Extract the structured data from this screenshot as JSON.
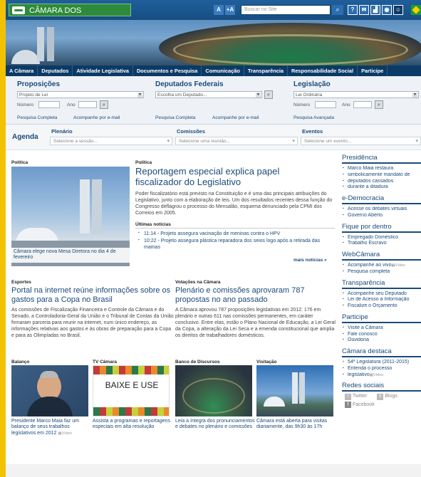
{
  "header": {
    "logo": "CÂMARA DOS DEPUTADOS",
    "font_smaller": "A",
    "font_larger": "+A",
    "search_placeholder": "Buscar no Site",
    "icons": [
      "help-icon",
      "mail-icon",
      "chart-icon",
      "rss-icon",
      "flag-icon"
    ],
    "help": "?"
  },
  "nav": [
    "A Câmara",
    "Deputados",
    "Atividade Legislativa",
    "Documentos e Pesquisa",
    "Comunicação",
    "Transparência",
    "Responsabilidade Social",
    "Participe"
  ],
  "panel": {
    "proposicoes": {
      "title": "Proposições",
      "select": "Projeto de Lei",
      "numero": "Número",
      "ano": "Ano",
      "link1": "Pesquisa Completa",
      "link2": "Acompanhe por e-mail"
    },
    "deputados": {
      "title": "Deputados Federais",
      "select": "Escolha um Deputado...",
      "link1": "Pesquisa Completa",
      "link2": "Acompanhe por e-mail"
    },
    "legislacao": {
      "title": "Legislação",
      "select": "Lei Ordinária",
      "numero": "Número",
      "ano": "Ano",
      "link1": "Pesquisa Avançada"
    }
  },
  "agenda": {
    "title": "Agenda",
    "plenario": "Plenário",
    "plenario_sel": "Selecione a sessão...",
    "comissoes": "Comissões",
    "comissoes_sel": "Selecione uma reunião...",
    "eventos": "Eventos",
    "eventos_sel": "Selecione um evento..."
  },
  "main": {
    "left_section": "Política",
    "photo_caption": "Câmara elege nova Mesa Diretora no dia 4 de fevereiro",
    "right_section": "Política",
    "headline": "Reportagem especial explica papel fiscalizador do Legislativo",
    "lead": "Poder fiscalizatório está previsto na Constituição e é uma das principais atribuições do Legislativo, junto com a elaboração de leis. Um dos resultados recentes dessa função do Congresso deflagrou o processo do Mensalão, esquema denunciado pela CPMI dos Correios em 2005.",
    "ultimas": "Últimas notícias",
    "news": [
      "11:14 - Projeto assegura vacinação de meninas contra o HPV",
      "10:22 - Projeto assegura plástica reparadora dos seios logo após a retirada das mamas"
    ],
    "more": "mais notícias »"
  },
  "stories": [
    {
      "section": "Esportes",
      "headline": "Portal na internet reúne informações sobre os gastos para a Copa no Brasil",
      "body": "As comissões de Fiscalização Financeira e Controle da Câmara e do Senado, a Controladoria-Geral da União e o Tribunal de Contas da União firmaram parceria para reunir na internet, num único endereço, as informações relativas aos gastos e às obras de preparação para a Copa e para as Olimpíadas no Brasil."
    },
    {
      "section": "Votações na Câmara",
      "headline": "Plenário e comissões aprovaram 787 propostas no ano passado",
      "body": "A Câmara aprovou 787 proposições legislativas em 2012: 176 em plenário e outras 611 nas comissões permanentes, em caráter conclusivo. Entre elas, estão o Plano Nacional de Educação, a Lei Geral da Copa, a alteração da Lei Seca e a emenda constitucional que amplia os direitos de trabalhadores domésticos."
    }
  ],
  "tiles": [
    {
      "section": "Balanço",
      "caption": "Presidente Marco Maia faz um balanço de seus trabalhos legislativos em 2012",
      "badge": "Vídeo"
    },
    {
      "section": "TV Câmara",
      "image_text": "BAIXE E USE",
      "caption": "Assista a programas e reportagens especiais em alta resolução"
    },
    {
      "section": "Banco de Discursos",
      "caption": "Leia a íntegra dos pronunciamentos e debates no plenário e comissões"
    },
    {
      "section": "Visitação",
      "caption": "Câmara está aberta para visitas diariamente, das 9h30 às 17h"
    }
  ],
  "sidebar": [
    {
      "title": "Presidência",
      "items": [
        "Marco Maia restaura",
        "simbolicamente mandato de",
        "deputados cassados",
        "durante a ditadura"
      ]
    },
    {
      "title": "e-Democracia",
      "items": [
        "Acesse os debates virtuais",
        "Governo Aberto"
      ]
    },
    {
      "title": "Fique por dentro",
      "items": [
        "Empregado Doméstico",
        "Trabalho Escravo"
      ]
    },
    {
      "title": "WebCâmara",
      "items": [
        "Acompanhe ao vivo",
        "Pesquisa completa"
      ],
      "badge": "Vídeo"
    },
    {
      "title": "Transparência",
      "items": [
        "Acompanhe seu Deputado",
        "Lei de Acesso à Informação",
        "Fiscalize o Orçamento"
      ]
    },
    {
      "title": "Participe",
      "items": [
        "Visite a Câmara",
        "Fale conosco",
        "Ouvidoria"
      ]
    },
    {
      "title": "Câmara destaca",
      "items": [
        "54ª Legislatura (2011-2015)",
        "Entenda o processo",
        "legislativo"
      ],
      "badge": "Vídeo"
    },
    {
      "title": "Redes sociais",
      "twitter": "Twitter",
      "blogs": "Blogs",
      "facebook": "Facebook"
    }
  ],
  "colors": {
    "navy": "#0c3a66",
    "link": "#1b4a7a",
    "yellow": "#f2c200",
    "green": "#2e8a3c"
  }
}
